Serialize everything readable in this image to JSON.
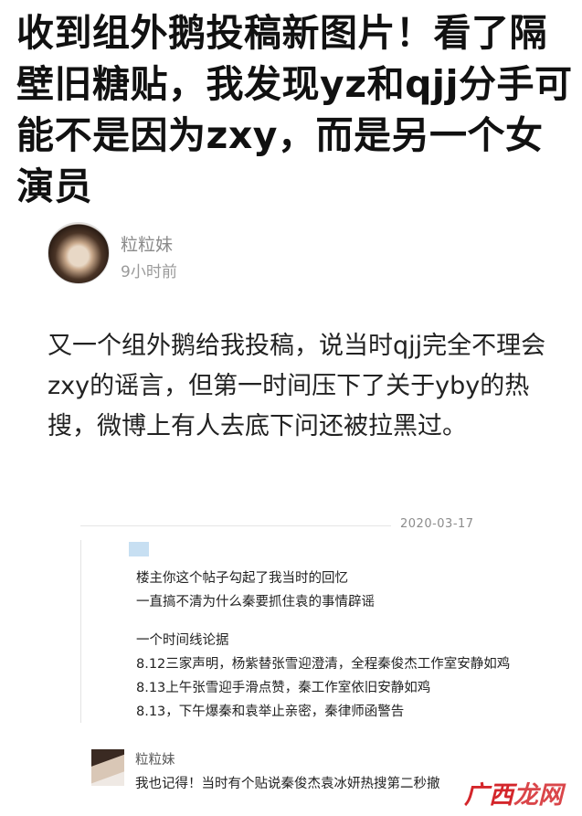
{
  "post": {
    "title": "收到组外鹅投稿新图片！看了隔壁旧糖贴，我发现yz和qjj分手可能不是因为zxy，而是另一个女演员",
    "author": {
      "name": "粒粒妹",
      "time": "9小时前"
    },
    "body": "又一个组外鹅给我投稿，说当时qjj完全不理会zxy的谣言，但第一时间压下了关于yby的热搜，微博上有人去底下问还被拉黑过。"
  },
  "embedded": {
    "date": "2020-03-17",
    "quote_lines": [
      "楼主你这个帖子勾起了我当时的回忆",
      "一直搞不清为什么秦要抓住袁的事情辟谣",
      "",
      "一个时间线论据",
      "8.12三家声明，杨紫替张雪迎澄清，全程秦俊杰工作室安静如鸡",
      "8.13上午张雪迎手滑点赞，秦工作室依旧安静如鸡",
      "8.13，下午爆秦和袁举止亲密，秦律师函警告"
    ],
    "reply": {
      "name": "粒粒妹",
      "text": "我也记得！当时有个贴说秦俊杰袁冰妍热搜第二秒撤"
    }
  },
  "watermark": {
    "part1": "广西",
    "part2": "龙网"
  }
}
